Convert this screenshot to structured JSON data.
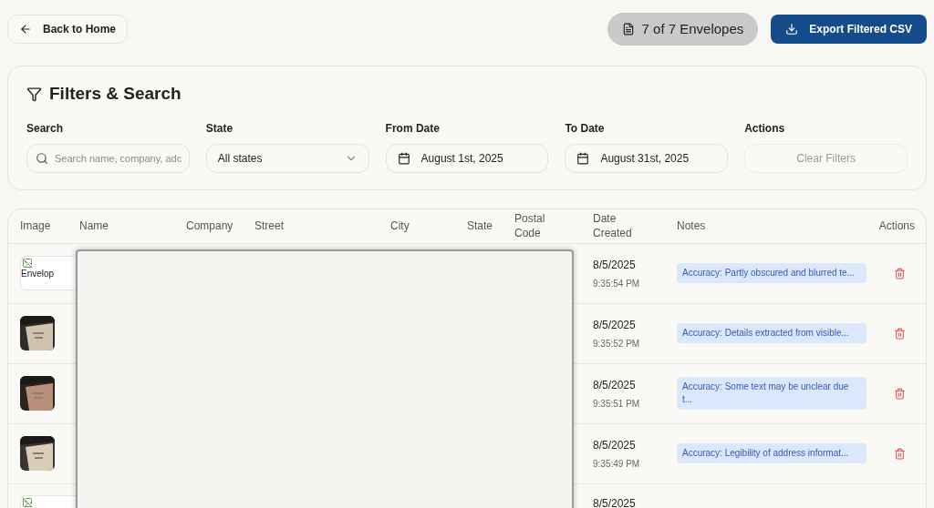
{
  "header": {
    "back_button": "Back to Home",
    "count_badge": "7 of 7 Envelopes",
    "export_button": "Export Filtered CSV"
  },
  "filters": {
    "title": "Filters & Search",
    "search": {
      "label": "Search",
      "placeholder": "Search name, company, adc"
    },
    "state": {
      "label": "State",
      "value": "All states"
    },
    "from_date": {
      "label": "From Date",
      "value": "August 1st, 2025"
    },
    "to_date": {
      "label": "To Date",
      "value": "August 31st, 2025"
    },
    "actions": {
      "label": "Actions",
      "button": "Clear Filters",
      "disabled": true
    }
  },
  "table": {
    "columns": [
      "Image",
      "Name",
      "Company",
      "Street",
      "City",
      "State",
      "Postal Code",
      "Date Created",
      "Notes",
      "Actions"
    ],
    "redacted": true,
    "rows": [
      {
        "image": {
          "kind": "broken",
          "alt": "Envelop"
        },
        "date": "8/5/2025",
        "time": "9:35:54 PM",
        "note": "Accuracy: Partly obscured and blurred te..."
      },
      {
        "date": "8/5/2025",
        "time": "9:35:52 PM",
        "note": "Accuracy: Details extracted from visible..."
      },
      {
        "date": "8/5/2025",
        "time": "9:35:51 PM",
        "note": "Accuracy: Some text may be unclear due t..."
      },
      {
        "date": "8/5/2025",
        "time": "9:35:49 PM",
        "note": "Accuracy: Legibility of address informat..."
      },
      {
        "image": {
          "kind": "broken"
        },
        "date": "8/5/2025"
      }
    ]
  }
}
